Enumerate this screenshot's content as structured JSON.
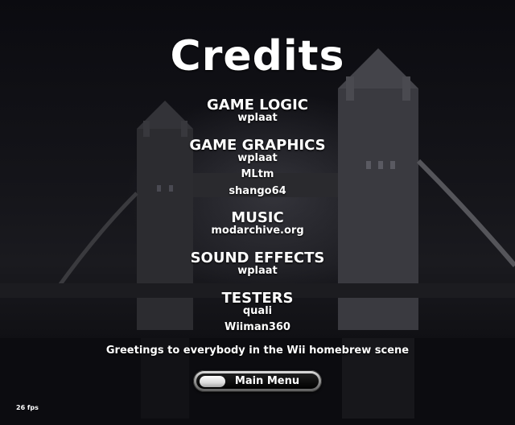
{
  "title": "Credits",
  "sections": [
    {
      "heading": "GAME LOGIC",
      "names": [
        "wplaat"
      ]
    },
    {
      "heading": "GAME GRAPHICS",
      "names": [
        "wplaat",
        "MLtm",
        "shango64"
      ]
    },
    {
      "heading": "MUSIC",
      "names": [
        "modarchive.org"
      ]
    },
    {
      "heading": "SOUND EFFECTS",
      "names": [
        "wplaat"
      ]
    },
    {
      "heading": "TESTERS",
      "names": [
        "quali",
        "Wiiman360"
      ]
    }
  ],
  "greeting": "Greetings to everybody in the Wii homebrew scene",
  "menu_button_label": "Main Menu",
  "fps_text": "26 fps",
  "background": "night-bridge-photo"
}
